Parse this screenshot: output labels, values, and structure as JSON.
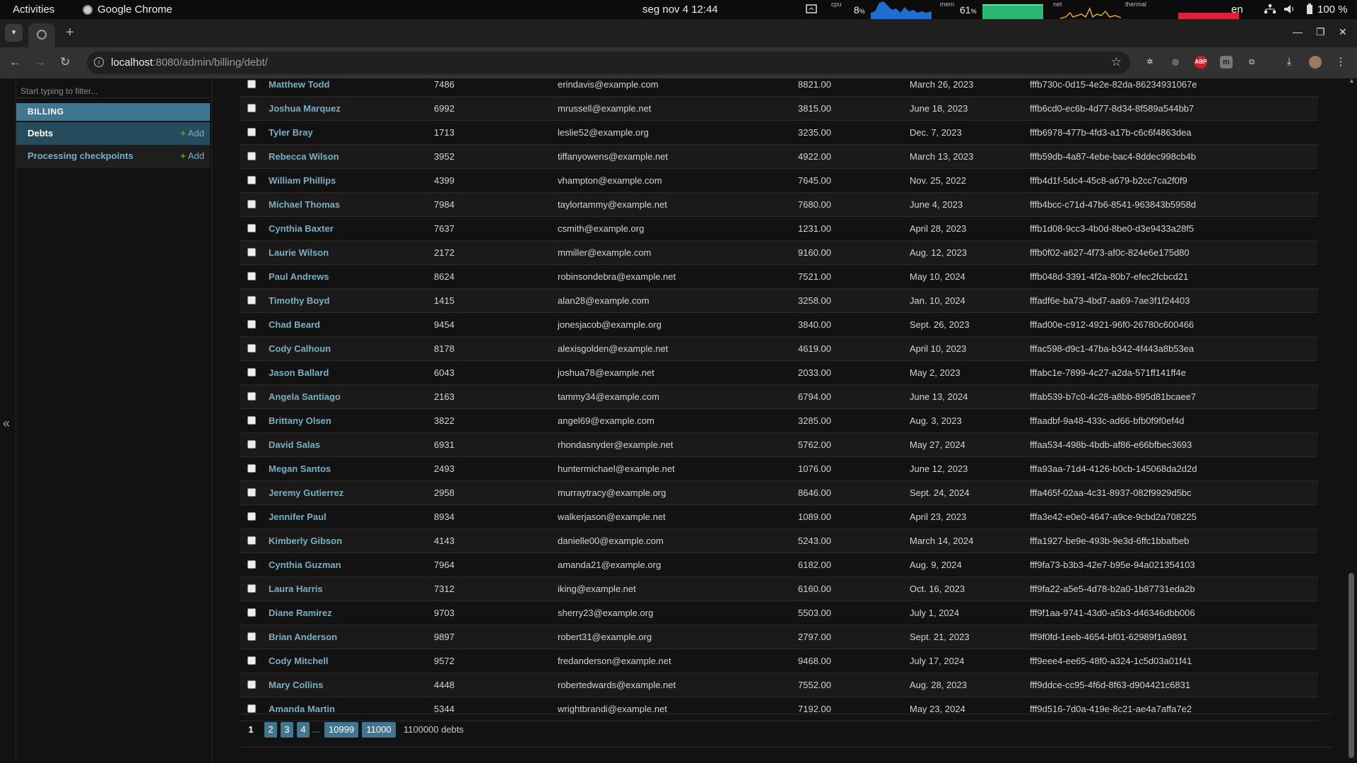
{
  "gnome": {
    "activities": "Activities",
    "app_name": "Google Chrome",
    "clock": "seg nov 4  12:44",
    "cpu_label": "cpu",
    "cpu_value": "8",
    "mem_label": "mem",
    "mem_value": "61",
    "net_label": "net",
    "thermal_label": "thermal",
    "percent_sign": "%",
    "lang": "en",
    "battery": "100 %"
  },
  "browser": {
    "url_host": "localhost",
    "url_rest": ":8080/admin/billing/debt/"
  },
  "sidebar": {
    "filter_placeholder": "Start typing to filter...",
    "app_caption": "BILLING",
    "items": [
      {
        "label": "Debts",
        "add": "Add",
        "current": true
      },
      {
        "label": "Processing checkpoints",
        "add": "Add",
        "current": false
      }
    ],
    "collapse_glyph": "«"
  },
  "results": [
    {
      "name": "Matthew Todd",
      "num": "7486",
      "email": "erindavis@example.com",
      "amount": "8821.00",
      "date": "March 26, 2023",
      "uuid": "fffb730c-0d15-4e2e-82da-86234931067e"
    },
    {
      "name": "Joshua Marquez",
      "num": "6992",
      "email": "mrussell@example.net",
      "amount": "3815.00",
      "date": "June 18, 2023",
      "uuid": "fffb6cd0-ec6b-4d77-8d34-8f589a544bb7"
    },
    {
      "name": "Tyler Bray",
      "num": "1713",
      "email": "leslie52@example.org",
      "amount": "3235.00",
      "date": "Dec. 7, 2023",
      "uuid": "fffb6978-477b-4fd3-a17b-c6c6f4863dea"
    },
    {
      "name": "Rebecca Wilson",
      "num": "3952",
      "email": "tiffanyowens@example.net",
      "amount": "4922.00",
      "date": "March 13, 2023",
      "uuid": "fffb59db-4a87-4ebe-bac4-8ddec998cb4b"
    },
    {
      "name": "William Phillips",
      "num": "4399",
      "email": "vhampton@example.com",
      "amount": "7645.00",
      "date": "Nov. 25, 2022",
      "uuid": "fffb4d1f-5dc4-45c8-a679-b2cc7ca2f0f9"
    },
    {
      "name": "Michael Thomas",
      "num": "7984",
      "email": "taylortammy@example.net",
      "amount": "7680.00",
      "date": "June 4, 2023",
      "uuid": "fffb4bcc-c71d-47b6-8541-963843b5958d"
    },
    {
      "name": "Cynthia Baxter",
      "num": "7637",
      "email": "csmith@example.org",
      "amount": "1231.00",
      "date": "April 28, 2023",
      "uuid": "fffb1d08-9cc3-4b0d-8be0-d3e9433a28f5"
    },
    {
      "name": "Laurie Wilson",
      "num": "2172",
      "email": "mmiller@example.com",
      "amount": "9160.00",
      "date": "Aug. 12, 2023",
      "uuid": "fffb0f02-a627-4f73-af0c-824e6e175d80"
    },
    {
      "name": "Paul Andrews",
      "num": "8624",
      "email": "robinsondebra@example.net",
      "amount": "7521.00",
      "date": "May 10, 2024",
      "uuid": "fffb048d-3391-4f2a-80b7-efec2fcbcd21"
    },
    {
      "name": "Timothy Boyd",
      "num": "1415",
      "email": "alan28@example.com",
      "amount": "3258.00",
      "date": "Jan. 10, 2024",
      "uuid": "fffadf6e-ba73-4bd7-aa69-7ae3f1f24403"
    },
    {
      "name": "Chad Beard",
      "num": "9454",
      "email": "jonesjacob@example.org",
      "amount": "3840.00",
      "date": "Sept. 26, 2023",
      "uuid": "fffad00e-c912-4921-96f0-26780c600466"
    },
    {
      "name": "Cody Calhoun",
      "num": "8178",
      "email": "alexisgolden@example.net",
      "amount": "4619.00",
      "date": "April 10, 2023",
      "uuid": "fffac598-d9c1-47ba-b342-4f443a8b53ea"
    },
    {
      "name": "Jason Ballard",
      "num": "6043",
      "email": "joshua78@example.net",
      "amount": "2033.00",
      "date": "May 2, 2023",
      "uuid": "fffabc1e-7899-4c27-a2da-571ff141ff4e"
    },
    {
      "name": "Angela Santiago",
      "num": "2163",
      "email": "tammy34@example.com",
      "amount": "6794.00",
      "date": "June 13, 2024",
      "uuid": "fffab539-b7c0-4c28-a8bb-895d81bcaee7"
    },
    {
      "name": "Brittany Olsen",
      "num": "3822",
      "email": "angel69@example.com",
      "amount": "3285.00",
      "date": "Aug. 3, 2023",
      "uuid": "fffaadbf-9a48-433c-ad66-bfb0f9f0ef4d"
    },
    {
      "name": "David Salas",
      "num": "6931",
      "email": "rhondasnyder@example.net",
      "amount": "5762.00",
      "date": "May 27, 2024",
      "uuid": "fffaa534-498b-4bdb-af86-e66bfbec3693"
    },
    {
      "name": "Megan Santos",
      "num": "2493",
      "email": "huntermichael@example.net",
      "amount": "1076.00",
      "date": "June 12, 2023",
      "uuid": "fffa93aa-71d4-4126-b0cb-145068da2d2d"
    },
    {
      "name": "Jeremy Gutierrez",
      "num": "2958",
      "email": "murraytracy@example.org",
      "amount": "8646.00",
      "date": "Sept. 24, 2024",
      "uuid": "fffa465f-02aa-4c31-8937-082f9929d5bc"
    },
    {
      "name": "Jennifer Paul",
      "num": "8934",
      "email": "walkerjason@example.net",
      "amount": "1089.00",
      "date": "April 23, 2023",
      "uuid": "fffa3e42-e0e0-4647-a9ce-9cbd2a708225"
    },
    {
      "name": "Kimberly Gibson",
      "num": "4143",
      "email": "danielle00@example.com",
      "amount": "5243.00",
      "date": "March 14, 2024",
      "uuid": "fffa1927-be9e-493b-9e3d-6ffc1bbafbeb"
    },
    {
      "name": "Cynthia Guzman",
      "num": "7964",
      "email": "amanda21@example.org",
      "amount": "6182.00",
      "date": "Aug. 9, 2024",
      "uuid": "fff9fa73-b3b3-42e7-b95e-94a021354103"
    },
    {
      "name": "Laura Harris",
      "num": "7312",
      "email": "iking@example.net",
      "amount": "6160.00",
      "date": "Oct. 16, 2023",
      "uuid": "fff9fa22-a5e5-4d78-b2a0-1b87731eda2b"
    },
    {
      "name": "Diane Ramirez",
      "num": "9703",
      "email": "sherry23@example.org",
      "amount": "5503.00",
      "date": "July 1, 2024",
      "uuid": "fff9f1aa-9741-43d0-a5b3-d46346dbb006"
    },
    {
      "name": "Brian Anderson",
      "num": "9897",
      "email": "robert31@example.org",
      "amount": "2797.00",
      "date": "Sept. 21, 2023",
      "uuid": "fff9f0fd-1eeb-4654-bf01-62989f1a9891"
    },
    {
      "name": "Cody Mitchell",
      "num": "9572",
      "email": "fredanderson@example.net",
      "amount": "9468.00",
      "date": "July 17, 2024",
      "uuid": "fff9eee4-ee65-48f0-a324-1c5d03a01f41"
    },
    {
      "name": "Mary Collins",
      "num": "4448",
      "email": "robertedwards@example.net",
      "amount": "7552.00",
      "date": "Aug. 28, 2023",
      "uuid": "fff9ddce-cc95-4f6d-8f63-d904421c6831"
    },
    {
      "name": "Amanda Martin",
      "num": "5344",
      "email": "wrightbrandi@example.net",
      "amount": "7192.00",
      "date": "May 23, 2024",
      "uuid": "fff9d516-7d0a-419e-8c21-ae4a7affa7e2"
    }
  ],
  "paginator": {
    "current": "1",
    "pages": [
      "2",
      "3",
      "4"
    ],
    "ellipsis": "...",
    "last_pages": [
      "10999",
      "11000"
    ],
    "total": "1100000 debts"
  },
  "colors": {
    "accent": "#79aec8",
    "module_header": "#417690",
    "selected_module": "#264b5d"
  }
}
